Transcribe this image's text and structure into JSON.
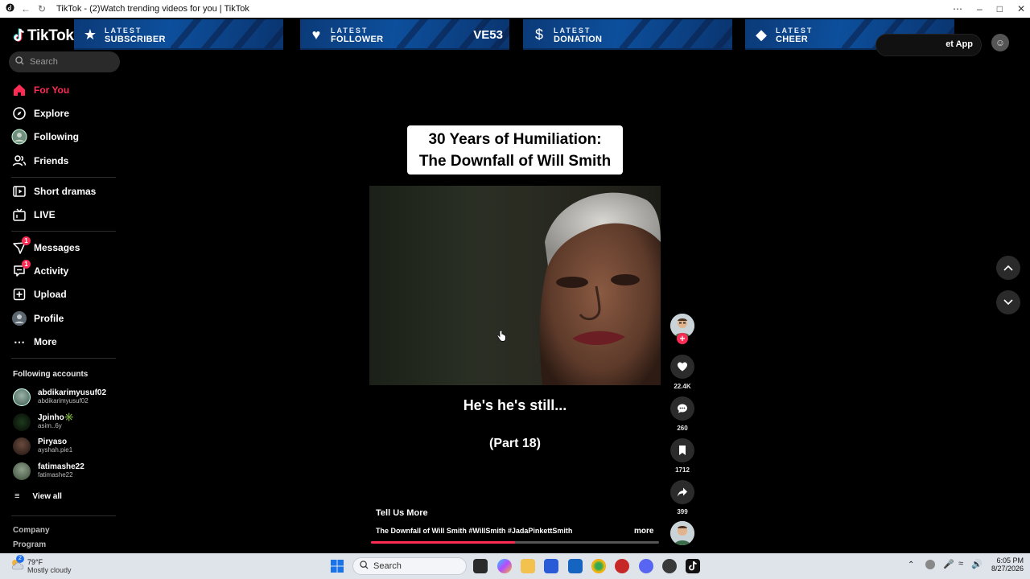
{
  "browser": {
    "title": "TikTok - (2)Watch trending videos for you | TikTok"
  },
  "banners": [
    {
      "line1": "LATEST",
      "line2": "SUBSCRIBER",
      "tag": "",
      "icon": "star-icon"
    },
    {
      "line1": "LATEST",
      "line2": "FOLLOWER",
      "tag": "VE53",
      "icon": "heart-icon"
    },
    {
      "line1": "LATEST",
      "line2": "DONATION",
      "tag": "",
      "icon": "dollar-icon"
    },
    {
      "line1": "LATEST",
      "line2": "CHEER",
      "tag": "",
      "icon": "diamond-icon"
    }
  ],
  "header": {
    "logo": "TikTok",
    "get_app": "et App"
  },
  "search": {
    "placeholder": "Search"
  },
  "nav": {
    "for_you": "For You",
    "explore": "Explore",
    "following": "Following",
    "friends": "Friends",
    "short_dramas": "Short dramas",
    "live": "LIVE",
    "messages": "Messages",
    "messages_badge": "1",
    "activity": "Activity",
    "activity_badge": "1",
    "upload": "Upload",
    "profile": "Profile",
    "more": "More"
  },
  "following_accounts": {
    "title": "Following accounts",
    "accounts": [
      {
        "name": "abdikarimyusuf02",
        "handle": "abdikarimyusuf02"
      },
      {
        "name": "Jpinho✳️",
        "handle": "asim..6y"
      },
      {
        "name": "Piryaso",
        "handle": "ayshah.pie1"
      },
      {
        "name": "fatimashe22",
        "handle": "fatimashe22"
      }
    ],
    "view_all": "View all"
  },
  "footer": {
    "company": "Company",
    "program": "Program"
  },
  "video": {
    "title_line1": "30 Years of Humiliation:",
    "title_line2": "The Downfall of Will Smith",
    "subtitle": "He's he's still...",
    "part": "(Part 18)",
    "author": "Tell Us More",
    "description": "The Downfall of Will Smith #WillSmith #JadaPinkettSmith",
    "more": "more",
    "progress": 0.5
  },
  "actions": {
    "likes": "22.4K",
    "comments": "260",
    "saves": "1712",
    "shares": "399"
  },
  "taskbar": {
    "temp": "79°F",
    "condition": "Mostly cloudy",
    "weather_badge": "2",
    "search": "Search",
    "time": "6:05 PM",
    "date": "8/27/2026"
  }
}
